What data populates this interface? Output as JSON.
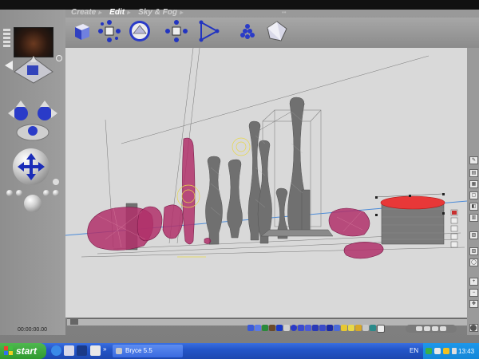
{
  "menu": {
    "items": [
      {
        "label": "Create",
        "active": false
      },
      {
        "label": "Edit",
        "active": true
      },
      {
        "label": "Sky & Fog",
        "active": false
      }
    ]
  },
  "toolbar": {
    "tools": [
      "cube-resize-icon",
      "rotate-icon",
      "sphere-edit-icon",
      "reposition-icon",
      "align-icon",
      "randomize-icon",
      "materials-icon"
    ]
  },
  "time_display": "00:00:00.00",
  "taskbar": {
    "start_label": "start",
    "task_label": "Bryce 5.5",
    "language": "EN",
    "clock": "13:43",
    "colors": {
      "bar": "#2456c9",
      "start": "#2f9a2f",
      "tray": "#1487d8"
    }
  },
  "scene": {
    "colors": {
      "selected": "#e83838",
      "terrain": "#b0306a",
      "primitive": "#6b6b6b",
      "light": "#e8d84a",
      "horizon": "#4a8ad8"
    }
  }
}
